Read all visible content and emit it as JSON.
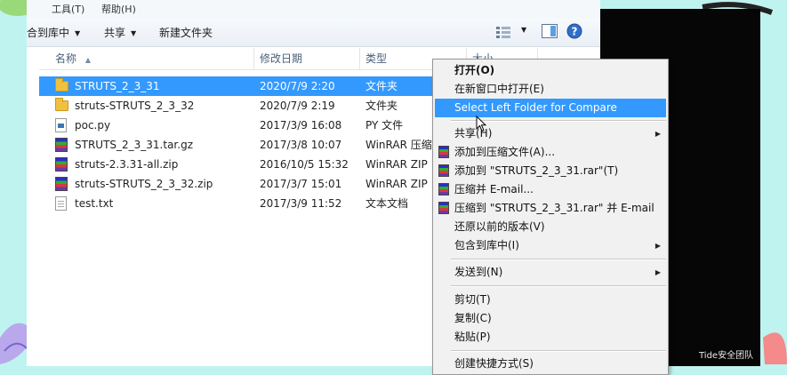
{
  "titlebar": {
    "crumb1": "工具(T)",
    "crumb2": "帮助(H)"
  },
  "toolbar": {
    "include_in_library": "合到库中",
    "share": "共享",
    "new_folder": "新建文件夹"
  },
  "columns": {
    "name": "名称",
    "date": "修改日期",
    "type": "类型",
    "size": "大小"
  },
  "files": [
    {
      "name": "STRUTS_2_3_31",
      "date": "2020/7/9 2:20",
      "type": "文件夹",
      "icon": "folder-icon",
      "selected": true
    },
    {
      "name": "struts-STRUTS_2_3_32",
      "date": "2020/7/9 2:19",
      "type": "文件夹",
      "icon": "folder-icon"
    },
    {
      "name": "poc.py",
      "date": "2017/3/9 16:08",
      "type": "PY 文件",
      "icon": "python-file-icon"
    },
    {
      "name": "STRUTS_2_3_31.tar.gz",
      "date": "2017/3/8 10:07",
      "type": "WinRAR 压缩",
      "icon": "winrar-icon"
    },
    {
      "name": "struts-2.3.31-all.zip",
      "date": "2016/10/5 15:32",
      "type": "WinRAR ZIP",
      "icon": "winrar-icon"
    },
    {
      "name": "struts-STRUTS_2_3_32.zip",
      "date": "2017/3/7 15:01",
      "type": "WinRAR ZIP",
      "icon": "winrar-icon"
    },
    {
      "name": "test.txt",
      "date": "2017/3/9 11:52",
      "type": "文本文档",
      "icon": "text-file-icon"
    }
  ],
  "context_menu": {
    "open": "打开(O)",
    "open_new_window": "在新窗口中打开(E)",
    "select_left_folder": "Select Left Folder for Compare",
    "share": "共享(H)",
    "add_to_archive": "添加到压缩文件(A)...",
    "add_to_rar": "添加到 \"STRUTS_2_3_31.rar\"(T)",
    "compress_email": "压缩并 E-mail...",
    "compress_to_rar_email": "压缩到 \"STRUTS_2_3_31.rar\" 并 E-mail",
    "restore_previous": "还原以前的版本(V)",
    "include_in_library": "包含到库中(I)",
    "send_to": "发送到(N)",
    "cut": "剪切(T)",
    "copy": "复制(C)",
    "paste": "粘贴(P)",
    "create_shortcut": "创建快捷方式(S)"
  },
  "watermark": "Tide安全团队",
  "colors": {
    "selection": "#3399ff",
    "background": "#bff3f0",
    "menu_bg": "#f1f1f1"
  }
}
